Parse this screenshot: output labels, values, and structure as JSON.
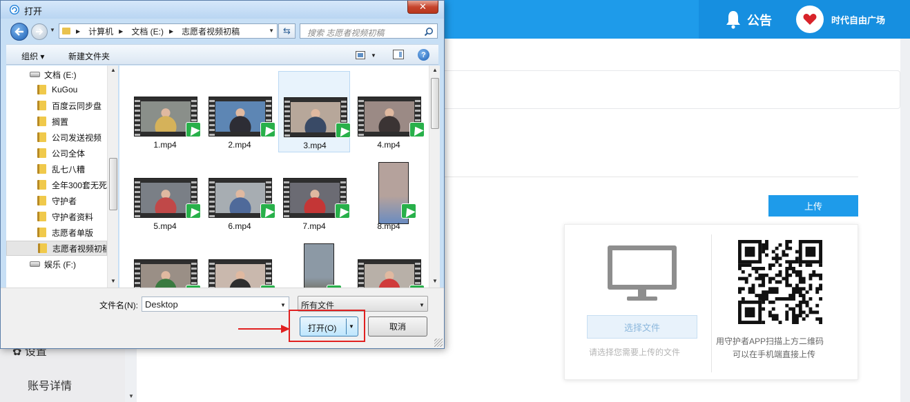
{
  "app": {
    "header": {
      "notice_label": "公告",
      "user_name": "时代自由广场"
    },
    "sidebar": {
      "settings_label": "设置",
      "account_label": "账号详情"
    },
    "upload": {
      "button_label": "上传",
      "choose_file_label": "选择文件",
      "choose_hint": "请选择您需要上传的文件",
      "qr_hint_line1": "用守护者APP扫描上方二维码",
      "qr_hint_line2": "可以在手机端直接上传"
    },
    "colors": {
      "brand_blue": "#1e9bea",
      "header_dark": "#168fe0"
    }
  },
  "dialog": {
    "title": "打开",
    "close_glyph": "✕",
    "breadcrumb": [
      "计算机",
      "文档 (E:)",
      "志愿者视频初稿"
    ],
    "search_placeholder": "搜索 志愿者视频初稿",
    "toolbar": {
      "organize_label": "组织 ▾",
      "new_folder_label": "新建文件夹",
      "help_glyph": "?"
    },
    "tree": [
      {
        "label": "文档 (E:)",
        "type": "drive"
      },
      {
        "label": "KuGou",
        "type": "folder"
      },
      {
        "label": "百度云同步盘",
        "type": "folder"
      },
      {
        "label": "搁置",
        "type": "folder"
      },
      {
        "label": "公司发送视频",
        "type": "folder"
      },
      {
        "label": "公司全体",
        "type": "folder"
      },
      {
        "label": "乱七八糟",
        "type": "folder"
      },
      {
        "label": "全年300套无死",
        "type": "folder"
      },
      {
        "label": "守护者",
        "type": "folder"
      },
      {
        "label": "守护者资料",
        "type": "folder"
      },
      {
        "label": "志愿者单版",
        "type": "folder"
      },
      {
        "label": "志愿者视频初稿",
        "type": "folder",
        "selected": true
      },
      {
        "label": "娱乐 (F:)",
        "type": "drive"
      }
    ],
    "files": [
      {
        "name": "1.mp4",
        "orientation": "landscape"
      },
      {
        "name": "2.mp4",
        "orientation": "landscape"
      },
      {
        "name": "3.mp4",
        "orientation": "landscape",
        "selected": true
      },
      {
        "name": "4.mp4",
        "orientation": "landscape"
      },
      {
        "name": "5.mp4",
        "orientation": "landscape"
      },
      {
        "name": "6.mp4",
        "orientation": "landscape"
      },
      {
        "name": "7.mp4",
        "orientation": "landscape"
      },
      {
        "name": "8.mp4",
        "orientation": "portrait"
      },
      {
        "name": "",
        "orientation": "landscape"
      },
      {
        "name": "",
        "orientation": "landscape"
      },
      {
        "name": "",
        "orientation": "portrait"
      },
      {
        "name": "",
        "orientation": "landscape"
      }
    ],
    "filename_label": "文件名(N):",
    "filename_value": "Desktop",
    "filetype_value": "所有文件",
    "open_label": "打开(O)",
    "cancel_label": "取消",
    "annotation_color": "#e02020"
  }
}
